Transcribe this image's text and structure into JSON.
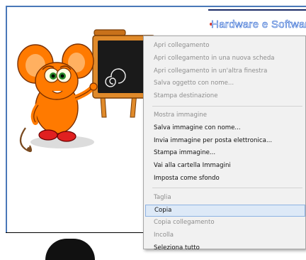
{
  "page": {
    "nav_link": "Hardware e Software"
  },
  "context_menu": {
    "groups": [
      [
        {
          "label": "Apri collegamento",
          "enabled": false
        },
        {
          "label": "Apri collegamento in una nuova scheda",
          "enabled": false
        },
        {
          "label": "Apri collegamento in un'altra finestra",
          "enabled": false
        },
        {
          "label": "Salva oggetto con nome...",
          "enabled": false
        },
        {
          "label": "Stampa destinazione",
          "enabled": false
        }
      ],
      [
        {
          "label": "Mostra immagine",
          "enabled": false
        },
        {
          "label": "Salva immagine con nome...",
          "enabled": true
        },
        {
          "label": "Invia immagine per posta elettronica...",
          "enabled": true
        },
        {
          "label": "Stampa immagine...",
          "enabled": true
        },
        {
          "label": "Vai alla cartella Immagini",
          "enabled": true
        },
        {
          "label": "Imposta come sfondo",
          "enabled": true
        }
      ],
      [
        {
          "label": "Taglia",
          "enabled": false
        },
        {
          "label": "Copia",
          "enabled": true,
          "highlighted": true
        },
        {
          "label": "Copia collegamento",
          "enabled": false
        },
        {
          "label": "Incolla",
          "enabled": false
        },
        {
          "label": "Seleziona tutto",
          "enabled": true
        }
      ]
    ]
  },
  "colors": {
    "menu_background": "#f1f1f1",
    "menu_highlight": "#dde9f7",
    "frame_accent": "#4a78b8",
    "mascot_body": "#ff7a00"
  }
}
